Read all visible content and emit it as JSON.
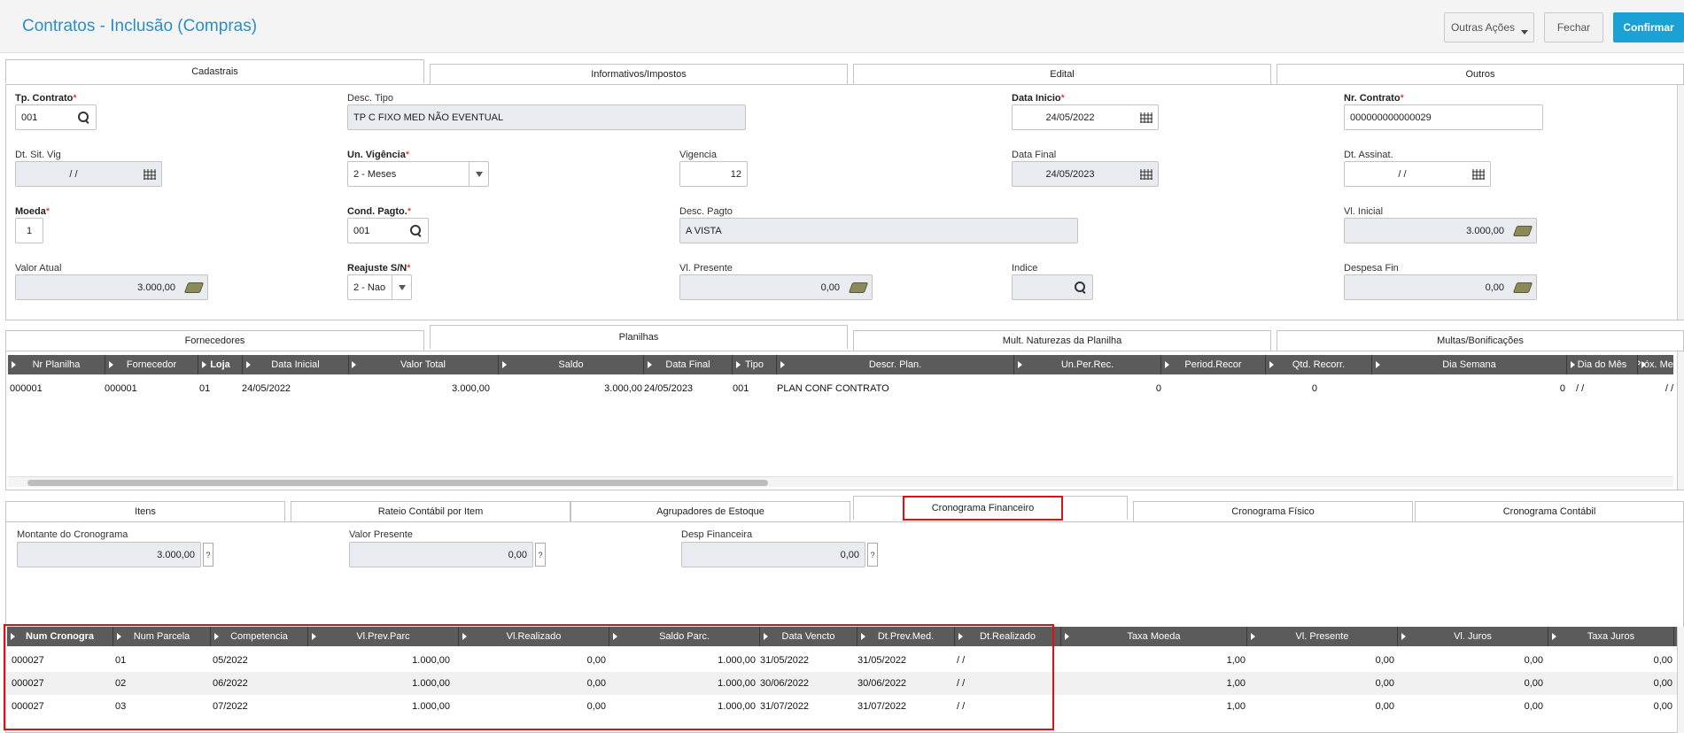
{
  "header": {
    "title": "Contratos - Inclusão (Compras)",
    "other_actions": "Outras Ações",
    "close": "Fechar",
    "confirm": "Confirmar"
  },
  "top_tabs": [
    "Cadastrais",
    "Informativos/Impostos",
    "Edital",
    "Outros"
  ],
  "form": {
    "tp_contrato": {
      "label": "Tp. Contrato",
      "value": "001"
    },
    "desc_tipo": {
      "label": "Desc. Tipo",
      "value": "TP C FIXO MED NÃO EVENTUAL"
    },
    "data_inicio": {
      "label": "Data Inicio",
      "value": "24/05/2022"
    },
    "nr_contrato": {
      "label": "Nr. Contrato",
      "value": "000000000000029"
    },
    "dt_sit_vig": {
      "label": "Dt. Sit. Vig",
      "value": "/  /"
    },
    "un_vigencia": {
      "label": "Un. Vigência",
      "value": "2 - Meses"
    },
    "vigencia": {
      "label": "Vigencia",
      "value": "12"
    },
    "data_final": {
      "label": "Data Final",
      "value": "24/05/2023"
    },
    "dt_assinat": {
      "label": "Dt. Assinat.",
      "value": "/  /"
    },
    "moeda": {
      "label": "Moeda",
      "value": "1"
    },
    "cond_pagto": {
      "label": "Cond. Pagto.",
      "value": "001"
    },
    "desc_pagto": {
      "label": "Desc. Pagto",
      "value": "A VISTA"
    },
    "vl_inicial": {
      "label": "Vl. Inicial",
      "value": "3.000,00"
    },
    "valor_atual": {
      "label": "Valor Atual",
      "value": "3.000,00"
    },
    "reajuste": {
      "label": "Reajuste S/N",
      "value": "2 - Nao"
    },
    "vl_presente": {
      "label": "Vl. Presente",
      "value": "0,00"
    },
    "indice": {
      "label": "Indice",
      "value": ""
    },
    "despesa_fin": {
      "label": "Despesa Fin",
      "value": "0,00"
    }
  },
  "mid_tabs": [
    "Fornecedores",
    "Planilhas",
    "Mult. Naturezas da Planilha",
    "Multas/Bonificações"
  ],
  "planilhas": {
    "columns": [
      "Nr Planilha",
      "Fornecedor",
      "Loja",
      "Data Inicial",
      "Valor Total",
      "Saldo",
      "Data Final",
      "Tipo",
      "Descr. Plan.",
      "Un.Per.Rec.",
      "Period.Recor",
      "Qtd. Recorr.",
      "Dia Semana",
      "Dia do Mês",
      "Próx. Med."
    ],
    "rows": [
      [
        "000001",
        "000001",
        "01",
        "24/05/2022",
        "3.000,00",
        "3.000,00",
        "24/05/2023",
        "001",
        "PLAN CONF CONTRATO",
        "",
        "0",
        "0",
        "",
        "0",
        "/  /",
        "/  /"
      ]
    ]
  },
  "sub_tabs": [
    "Itens",
    "Rateio Contábil por Item",
    "Agrupadores de Estoque",
    "Cronograma Financeiro",
    "Cronograma Físico",
    "Cronograma Contábil"
  ],
  "cronograma": {
    "montante": {
      "label": "Montante do Cronograma",
      "value": "3.000,00"
    },
    "valor_presente": {
      "label": "Valor Presente",
      "value": "0,00"
    },
    "desp_financeira": {
      "label": "Desp Financeira",
      "value": "0,00"
    },
    "help": "?"
  },
  "cron_grid": {
    "columns": [
      "Num Cronogra",
      "Num Parcela",
      "Competencia",
      "Vl.Prev.Parc",
      "Vl.Realizado",
      "Saldo Parc.",
      "Data Vencto",
      "Dt.Prev.Med.",
      "Dt.Realizado",
      "Taxa Moeda",
      "Vl. Presente",
      "Vl. Juros",
      "Taxa Juros"
    ],
    "rows": [
      [
        "000027",
        "01",
        "05/2022",
        "1.000,00",
        "0,00",
        "1.000,00",
        "31/05/2022",
        "31/05/2022",
        "/  /",
        "1,00",
        "0,00",
        "0,00",
        "0,00"
      ],
      [
        "000027",
        "02",
        "06/2022",
        "1.000,00",
        "0,00",
        "1.000,00",
        "30/06/2022",
        "30/06/2022",
        "/  /",
        "1,00",
        "0,00",
        "0,00",
        "0,00"
      ],
      [
        "000027",
        "03",
        "07/2022",
        "1.000,00",
        "0,00",
        "1.000,00",
        "31/07/2022",
        "31/07/2022",
        "/  /",
        "1,00",
        "0,00",
        "0,00",
        "0,00"
      ]
    ]
  }
}
